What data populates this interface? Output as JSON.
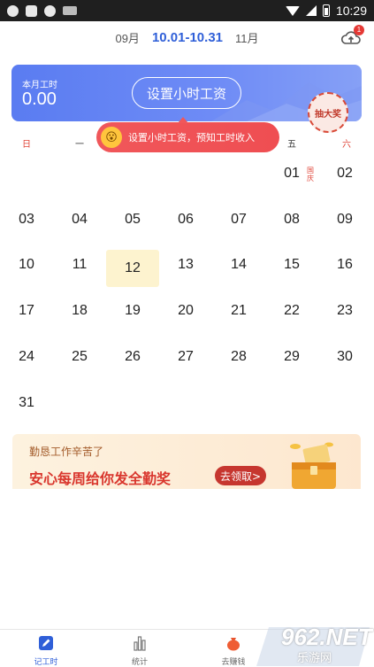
{
  "status_bar": {
    "time": "10:29"
  },
  "header": {
    "prev_month": "09月",
    "current_range": "10.01-10.31",
    "next_month": "11月",
    "cloud_badge": "1"
  },
  "card": {
    "label": "本月工时",
    "value": "0.00",
    "button": "设置小时工资",
    "lottery": "抽大奖"
  },
  "tip": {
    "text": "设置小时工资，预知工时收入"
  },
  "weekdays": [
    "日",
    "一",
    "二",
    "三",
    "四",
    "五",
    "六"
  ],
  "calendar": {
    "weeks": [
      [
        "",
        "",
        "",
        "",
        "",
        "01",
        "02"
      ],
      [
        "03",
        "04",
        "05",
        "06",
        "07",
        "08",
        "09"
      ],
      [
        "10",
        "11",
        "12",
        "13",
        "14",
        "15",
        "16"
      ],
      [
        "17",
        "18",
        "19",
        "20",
        "21",
        "22",
        "23"
      ],
      [
        "24",
        "25",
        "26",
        "27",
        "28",
        "29",
        "30"
      ],
      [
        "31",
        "",
        "",
        "",
        "",
        "",
        ""
      ]
    ],
    "today": "12",
    "holiday_label": "国庆"
  },
  "banner": {
    "subtitle": "勤恳工作辛苦了",
    "main_a": "安心每周给你发",
    "main_b": "全勤奖",
    "cta": "去领取>"
  },
  "bottom_nav": [
    {
      "label": "记工时",
      "icon": "pencil-icon",
      "active": true
    },
    {
      "label": "统计",
      "icon": "bar-chart-icon",
      "active": false
    },
    {
      "label": "去赚钱",
      "icon": "money-bag-icon",
      "active": false
    }
  ],
  "watermark": {
    "text": "962.NET",
    "sub": "乐游网"
  },
  "colors": {
    "accent": "#2f5fd8",
    "card": "#5a7cf1",
    "weekend": "#e0463a",
    "today_bg": "#fdf3cf",
    "tip": "#f0575a"
  }
}
